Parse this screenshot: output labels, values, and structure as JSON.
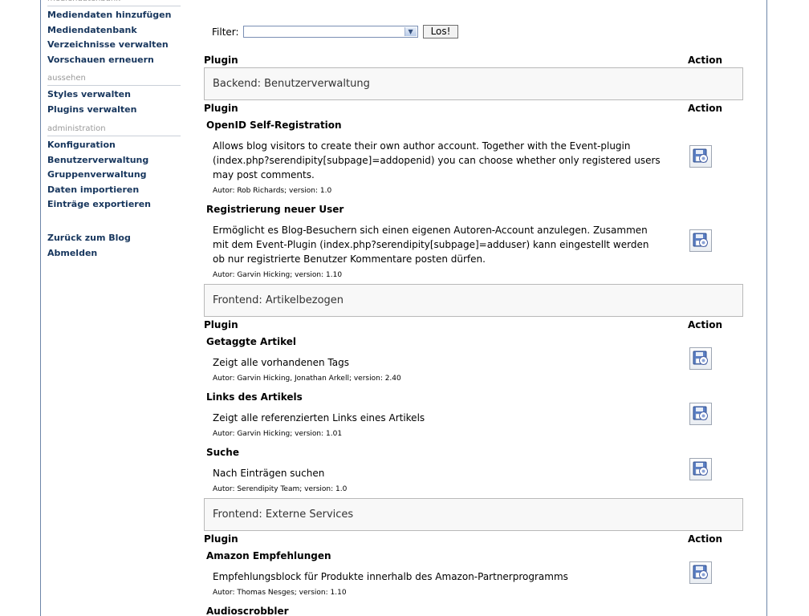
{
  "sidebar": {
    "top_cut_label": "mediendatenbank",
    "media_links": [
      "Mediendaten hinzufügen",
      "Mediendatenbank",
      "Verzeichnisse verwalten",
      "Vorschauen erneuern"
    ],
    "cat_appearance": "aussehen",
    "appearance_links": [
      "Styles verwalten",
      "Plugins verwalten"
    ],
    "cat_admin": "administration",
    "admin_links": [
      "Konfiguration",
      "Benutzerverwaltung",
      "Gruppenverwaltung",
      "Daten importieren",
      "Einträge exportieren"
    ],
    "bottom_links": [
      "Zurück zum Blog",
      "Abmelden"
    ]
  },
  "filter": {
    "label": "Filter:",
    "selected": "",
    "button": "Los!"
  },
  "headers": {
    "plugin": "Plugin",
    "action": "Action"
  },
  "sections": [
    "Backend: Benutzerverwaltung",
    "Frontend: Artikelbezogen",
    "Frontend: Externe Services"
  ],
  "plugins": [
    {
      "title": "OpenID Self-Registration",
      "description": "Allows blog visitors to create their own author account. Together with the Event-plugin (index.php?serendipity[subpage]=addopenid) you can choose whether only registered users may post comments.",
      "meta": "Autor: Rob Richards; version: 1.0"
    },
    {
      "title": "Registrierung neuer User",
      "description": "Ermöglicht es Blog-Besuchern sich einen eigenen Autoren-Account anzulegen. Zusammen mit dem Event-Plugin (index.php?serendipity[subpage]=adduser) kann eingestellt werden ob nur registrierte Benutzer Kommentare posten dürfen.",
      "meta": "Autor: Garvin Hicking; version: 1.10"
    },
    {
      "title": "Getaggte Artikel",
      "description": "Zeigt alle vorhandenen Tags",
      "meta": "Autor: Garvin Hicking, Jonathan Arkell; version: 2.40"
    },
    {
      "title": "Links des Artikels",
      "description": "Zeigt alle referenzierten Links eines Artikels",
      "meta": "Autor: Garvin Hicking; version: 1.01"
    },
    {
      "title": "Suche",
      "description": "Nach Einträgen suchen",
      "meta": "Autor: Serendipity Team; version: 1.0"
    },
    {
      "title": "Amazon Empfehlungen",
      "description": "Empfehlungsblock für Produkte innerhalb des Amazon-Partnerprogramms",
      "meta": "Autor: Thomas Nesges; version: 1.10"
    },
    {
      "title": "Audioscrobbler",
      "description": "",
      "meta": ""
    }
  ],
  "icons": {
    "install": "install-disk-icon",
    "select_arrow": "chevron-down-icon"
  }
}
